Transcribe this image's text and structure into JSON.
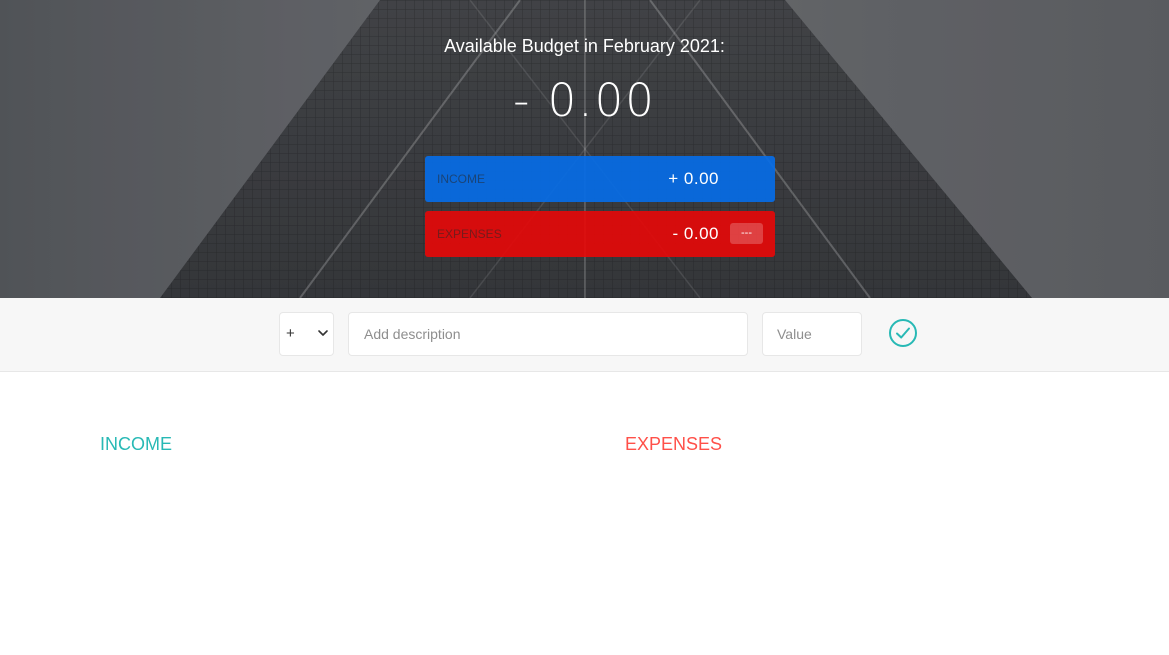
{
  "header": {
    "title": "Available Budget in February 2021:",
    "budget_value": "- 0.00",
    "income": {
      "label": "Income",
      "value": "+ 0.00"
    },
    "expenses": {
      "label": "Expenses",
      "value": "- 0.00",
      "percentage": "---"
    }
  },
  "add_form": {
    "type_selected": "+",
    "type_options": [
      "+",
      "-"
    ],
    "description_placeholder": "Add description",
    "value_placeholder": "Value",
    "submit_icon": "checkmark-circle-icon"
  },
  "lists": {
    "income_title": "Income",
    "expenses_title": "Expenses"
  },
  "colors": {
    "income_accent": "#28b9b5",
    "expenses_accent": "#ff5049",
    "income_bar": "#066ce6",
    "expenses_bar": "#e80808"
  }
}
